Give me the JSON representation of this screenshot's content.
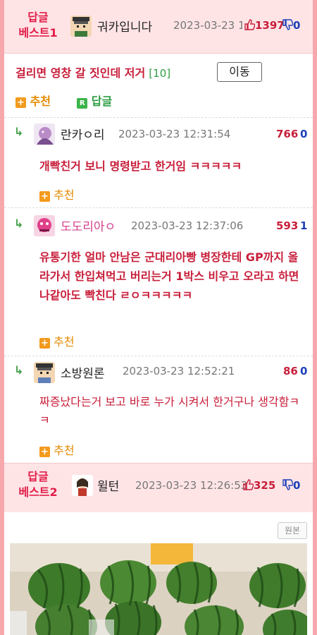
{
  "best1": {
    "tag_line1": "답글",
    "tag_line2": "베스트1",
    "nick": "궈카입니다",
    "date": "2023-03-23 10:51:47",
    "up": "1397",
    "down": "0"
  },
  "post": {
    "title": "걸리면 영창 갈 짓인데 저거",
    "count": "[10]",
    "move_label": "이동",
    "recommend_label": "추천",
    "reply_label": "답글"
  },
  "comments": [
    {
      "nick": "란카ㅇ리",
      "date": "2023-03-23 12:31:54",
      "up": "766",
      "down": "0",
      "text": "개빡친거 보니 명령받고 한거임 ㅋㅋㅋㅋㅋ",
      "recommend_label": "추천"
    },
    {
      "nick": "도도리아ㅇ",
      "date": "2023-03-23 12:37:06",
      "up": "593",
      "down": "1",
      "text": "유통기한 얼마 안남은 군대리아빵 병장한테 GP까지 올라가서 한입쳐먹고 버리는거 1박스 비우고 오라고 하면 나같아도 빡친다 ㄹㅇㅋㅋㅋㅋㅋ",
      "recommend_label": "추천"
    },
    {
      "nick": "소방원론",
      "date": "2023-03-23 12:52:21",
      "up": "86",
      "down": "0",
      "text": "짜증났다는거 보고 바로 누가 시켜서 한거구나 생각함ㅋㅋ",
      "recommend_label": "추천"
    }
  ],
  "best2": {
    "tag_line1": "답글",
    "tag_line2": "베스트2",
    "nick": "윌턴",
    "date": "2023-03-23 12:26:53",
    "up": "325",
    "down": "0",
    "orig_label": "원본"
  },
  "colors": {
    "accent": "#c81e3a",
    "best_bg": "#ffe4e6",
    "frame_bg": "#f7a8ad",
    "recommend": "#e48a00",
    "reply": "#2f9e44"
  },
  "icons": [
    "thumbs-up-icon",
    "thumbs-down-icon",
    "plus-icon",
    "reply-arrow-icon",
    "reply-badge-icon"
  ]
}
